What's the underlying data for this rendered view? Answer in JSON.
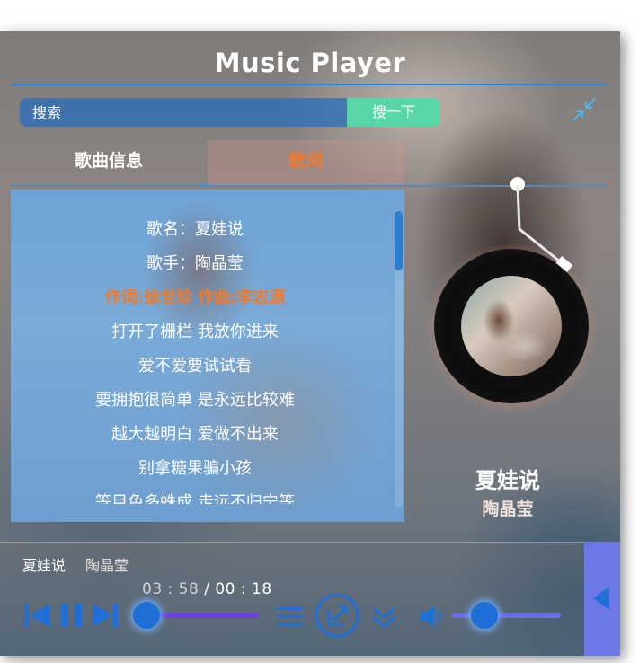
{
  "app": {
    "title": "Music Player"
  },
  "search": {
    "placeholder": "搜索",
    "button_label": "搜一下"
  },
  "tabs": [
    {
      "label": "歌曲信息",
      "active": false
    },
    {
      "label": "歌词",
      "active": true
    }
  ],
  "lyrics": {
    "lines": [
      "歌名：夏娃说",
      "歌手：陶晶莹",
      "作词:徐世珍 作曲:李志源",
      "打开了栅栏   我放你进来",
      "爱不爱要试试看",
      "要拥抱很简单 是永远比较难",
      "越大越明白   爱做不出来",
      "别拿糖果骗小孩",
      "等目色多蛛成 走远不归宁等"
    ],
    "highlighted_line": 2
  },
  "now_playing": {
    "title": "夏娃说",
    "artist": "陶晶莹"
  },
  "player": {
    "song_label": "夏娃说",
    "artist_label": "陶晶莹",
    "current_time": "03 : 58",
    "separator": " / ",
    "total_time": "00 : 18",
    "progress": 0.0,
    "volume": 0.3
  },
  "icons": {
    "shrink": "shrink-arrows-icon",
    "prev": "skip-previous-icon",
    "pause": "pause-icon",
    "next": "skip-next-icon",
    "list": "playlist-icon",
    "share": "share-icon",
    "download": "double-chevron-down-icon",
    "volume": "volume-icon",
    "side": "triangle-left-icon"
  },
  "colors": {
    "accent_blue": "#1f6fd6",
    "highlight_orange": "#f07a2c",
    "search_button": "#58d6a8",
    "progress_fill": "#6b3fe0",
    "side_toggle": "#6b78e6"
  }
}
